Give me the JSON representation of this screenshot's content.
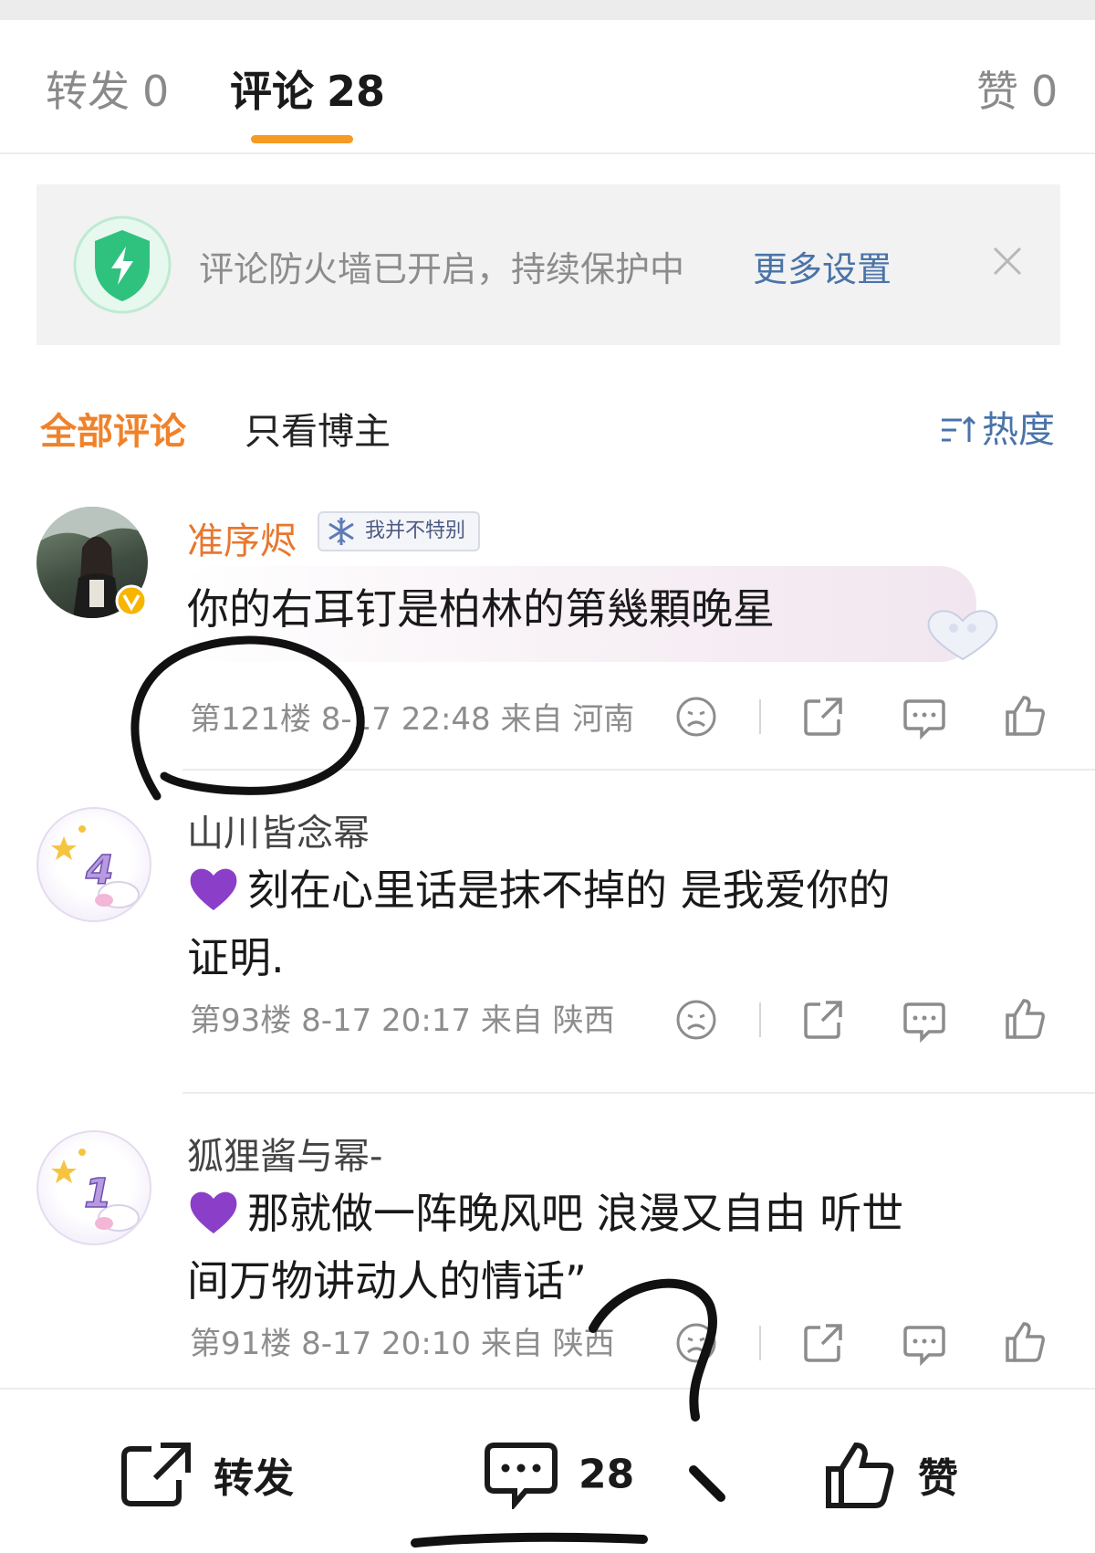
{
  "tabs": {
    "repost_label": "转发",
    "repost_count": "0",
    "comment_label": "评论",
    "comment_count": "28",
    "like_label": "赞",
    "like_count": "0"
  },
  "firewall": {
    "text": "评论防火墙已开启，持续保护中",
    "link": "更多设置"
  },
  "filter": {
    "all": "全部评论",
    "owner_only": "只看博主",
    "sort": "热度"
  },
  "comments": [
    {
      "name": "准序烬",
      "badge": "我并不特别",
      "text": "你的右耳钉是柏林的第幾顆晚星",
      "floor": "第121楼",
      "time": "8-17 22:48",
      "location": "来自 河南",
      "name_color": "#e8772e"
    },
    {
      "name": "山川皆念幂",
      "text_line1": "刻在心里话是抹不掉的 是我爱你的",
      "text_line2": "证明.",
      "floor": "第93楼",
      "time": "8-17 20:17",
      "location": "来自 陕西",
      "avatar_number": "4"
    },
    {
      "name": "狐狸酱与幂-",
      "text_line1": "那就做一阵晚风吧 浪漫又自由 听世",
      "text_line2": "间万物讲动人的情话”",
      "floor": "第91楼",
      "time": "8-17 20:10",
      "location": "来自 陕西",
      "avatar_number": "1"
    }
  ],
  "bottom_bar": {
    "repost": "转发",
    "comments": "28",
    "like": "赞"
  },
  "colors": {
    "accent_orange": "#f59a23",
    "link_blue": "#4a73a8",
    "heart_purple": "#8b3fc8",
    "shield_green": "#2ec27e"
  }
}
